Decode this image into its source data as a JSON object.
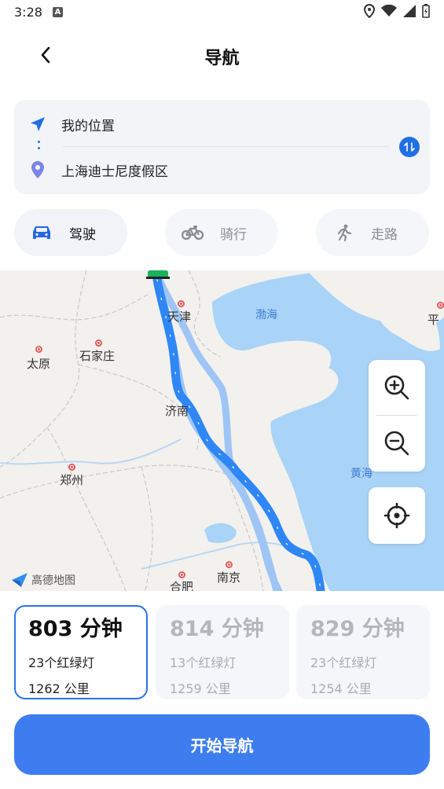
{
  "status_bar": {
    "time": "3:28",
    "notif_letter": "A"
  },
  "header": {
    "title": "导航"
  },
  "route_input": {
    "from": "我的位置",
    "to": "上海迪士尼度假区"
  },
  "modes": [
    {
      "label": "驾驶",
      "icon": "car-icon",
      "active": true
    },
    {
      "label": "骑行",
      "icon": "bicycle-icon",
      "active": false
    },
    {
      "label": "走路",
      "icon": "walk-icon",
      "active": false
    }
  ],
  "map": {
    "labels": {
      "tianjin": "天津",
      "bohai": "渤海",
      "taiyuan": "太原",
      "shijiazhuang": "石家庄",
      "jinan": "济南",
      "zhengzhou": "郑州",
      "huanghai": "黄海",
      "hefei": "合肥",
      "nanjing": "南京",
      "ping": "平"
    },
    "logo_text": "高德地图"
  },
  "route_options": [
    {
      "time": "803 分钟",
      "lights": "23个红绿灯",
      "distance": "1262 公里",
      "selected": true
    },
    {
      "time": "814 分钟",
      "lights": "13个红绿灯",
      "distance": "1259 公里",
      "selected": false
    },
    {
      "time": "829 分钟",
      "lights": "23个红绿灯",
      "distance": "1254 公里",
      "selected": false
    }
  ],
  "start_button": {
    "label": "开始导航"
  },
  "colors": {
    "accent": "#3d7df0",
    "route_primary": "#2f86f5",
    "route_alt": "#9ec5f5",
    "sea": "#a9d3f7"
  }
}
